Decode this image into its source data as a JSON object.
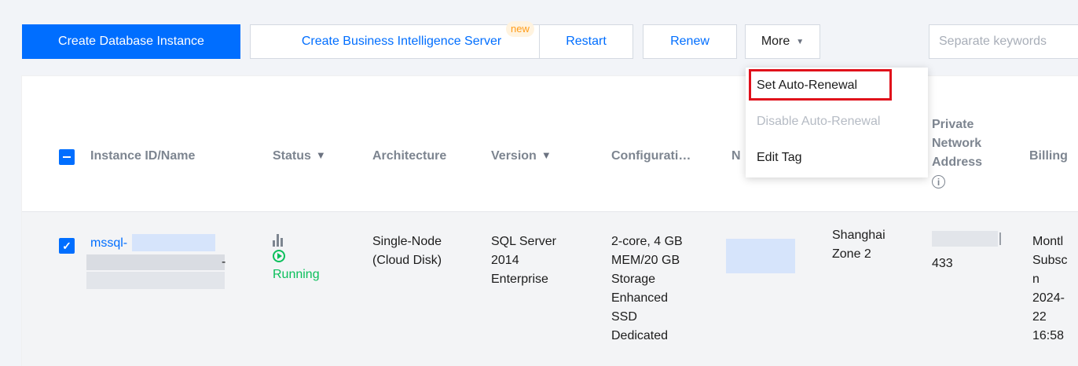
{
  "toolbar": {
    "create_instance": "Create Database Instance",
    "create_bi_server": "Create Business Intelligence Server",
    "new_badge": "new",
    "restart": "Restart",
    "renew": "Renew",
    "more": "More",
    "search_placeholder": "Separate keywords"
  },
  "more_menu": {
    "items": [
      {
        "label": "Set Auto-Renewal",
        "enabled": true,
        "highlighted": true
      },
      {
        "label": "Disable Auto-Renewal",
        "enabled": false
      },
      {
        "label": "Edit Tag",
        "enabled": true
      }
    ]
  },
  "table": {
    "columns": {
      "instance": "Instance ID/Name",
      "status": "Status",
      "architecture": "Architecture",
      "version": "Version",
      "configuration": "Configurati…",
      "network": "N",
      "private_address": [
        "Private",
        "Network",
        "Address"
      ],
      "billing": "Billing"
    },
    "row": {
      "instance_id": "mssql-",
      "instance_fragment": "-",
      "status": "Running",
      "architecture": [
        "Single-Node",
        "(Cloud Disk)"
      ],
      "version": [
        "SQL Server",
        "2014",
        "Enterprise"
      ],
      "configuration": [
        "2-core, 4 GB",
        "MEM/20 GB",
        "Storage",
        "Enhanced",
        "SSD",
        "Dedicated"
      ],
      "region": [
        "Shanghai",
        "Zone 2"
      ],
      "port": "433",
      "billing": [
        "Montl",
        "Subsc",
        "n",
        "2024-",
        "22",
        "16:58"
      ]
    }
  },
  "colors": {
    "primary": "#006eff",
    "running": "#0abf5b",
    "highlight": "#e0101b"
  }
}
